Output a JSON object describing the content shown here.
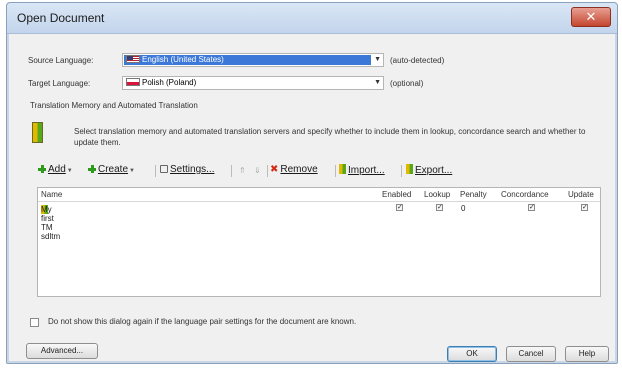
{
  "window": {
    "title": "Open Document",
    "close_glyph": "✕"
  },
  "source": {
    "label": "Source Language:",
    "value": "English (United States)",
    "flag_icon": "us-flag-icon",
    "note": "(auto-detected)"
  },
  "target": {
    "label": "Target Language:",
    "value": "Polish (Poland)",
    "flag_icon": "pl-flag-icon",
    "note": "(optional)"
  },
  "tm_section": {
    "heading": "Translation Memory and Automated Translation",
    "description": "Select translation memory and automated translation servers and specify whether to include them in lookup, concordance search and whether to update them."
  },
  "toolbar": {
    "add": "Add",
    "create": "Create",
    "settings": "Settings...",
    "up": "⇑",
    "down": "⇓",
    "remove": "Remove",
    "import": "Import...",
    "export": "Export..."
  },
  "list": {
    "columns": {
      "name": "Name",
      "enabled": "Enabled",
      "lookup": "Lookup",
      "penalty": "Penalty",
      "concordance": "Concordance",
      "update": "Update"
    },
    "rows": [
      {
        "name": "My first TM sdltm",
        "enabled": "✓",
        "lookup": "✓",
        "penalty": "0",
        "concordance": "✓",
        "update": "✓"
      }
    ]
  },
  "footer": {
    "checkbox_label": "Do not show this dialog again if the language pair settings for the document are known.",
    "advanced": "Advanced...",
    "ok": "OK",
    "cancel": "Cancel",
    "help": "Help"
  },
  "colors": {
    "selection": "#3b78d8",
    "title_bar": "#c3d5ec",
    "close_button": "#c4462f"
  }
}
